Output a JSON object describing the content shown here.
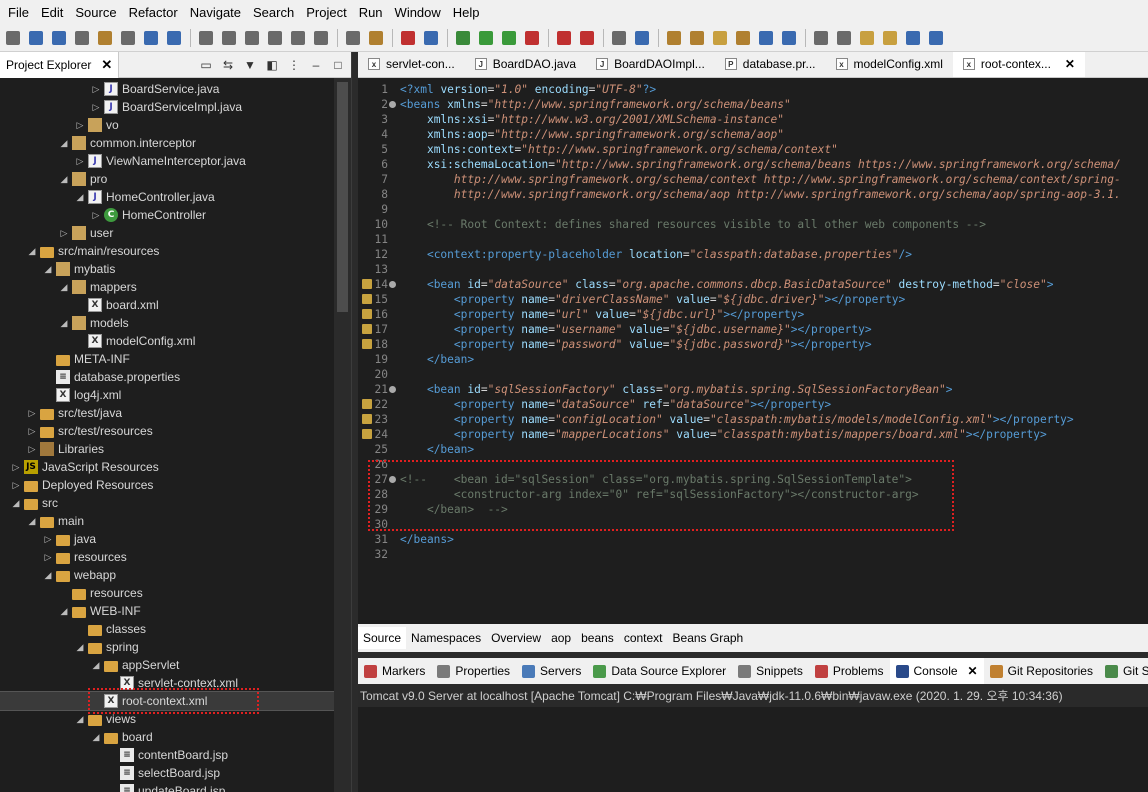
{
  "menu": [
    "File",
    "Edit",
    "Source",
    "Refactor",
    "Navigate",
    "Search",
    "Project",
    "Run",
    "Window",
    "Help"
  ],
  "explorer": {
    "title": "Project Explorer",
    "close": "✕",
    "tree": [
      {
        "label": "BoardService.java",
        "icon": "java",
        "tw": "▷",
        "indent": 104
      },
      {
        "label": "BoardServiceImpl.java",
        "icon": "java",
        "tw": "▷",
        "indent": 104
      },
      {
        "label": "vo",
        "icon": "pkg",
        "tw": "▷",
        "indent": 88
      },
      {
        "label": "common.interceptor",
        "icon": "pkg",
        "tw": "◢",
        "indent": 72
      },
      {
        "label": "ViewNameInterceptor.java",
        "icon": "java",
        "tw": "▷",
        "indent": 88
      },
      {
        "label": "pro",
        "icon": "pkg",
        "tw": "◢",
        "indent": 72
      },
      {
        "label": "HomeController.java",
        "icon": "java",
        "tw": "◢",
        "indent": 88
      },
      {
        "label": "HomeController",
        "icon": "cls",
        "tw": "▷",
        "indent": 104
      },
      {
        "label": "user",
        "icon": "pkg",
        "tw": "▷",
        "indent": 72
      },
      {
        "label": "src/main/resources",
        "icon": "folder",
        "tw": "◢",
        "indent": 40
      },
      {
        "label": "mybatis",
        "icon": "pkg",
        "tw": "◢",
        "indent": 56
      },
      {
        "label": "mappers",
        "icon": "pkg",
        "tw": "◢",
        "indent": 72
      },
      {
        "label": "board.xml",
        "icon": "xml",
        "tw": "",
        "indent": 88
      },
      {
        "label": "models",
        "icon": "pkg",
        "tw": "◢",
        "indent": 72
      },
      {
        "label": "modelConfig.xml",
        "icon": "xml",
        "tw": "",
        "indent": 88
      },
      {
        "label": "META-INF",
        "icon": "folder",
        "tw": "",
        "indent": 56
      },
      {
        "label": "database.properties",
        "icon": "props",
        "tw": "",
        "indent": 56
      },
      {
        "label": "log4j.xml",
        "icon": "xml",
        "tw": "",
        "indent": 56
      },
      {
        "label": "src/test/java",
        "icon": "folder",
        "tw": "▷",
        "indent": 40
      },
      {
        "label": "src/test/resources",
        "icon": "folder",
        "tw": "▷",
        "indent": 40
      },
      {
        "label": "Libraries",
        "icon": "lib",
        "tw": "▷",
        "indent": 40
      },
      {
        "label": "JavaScript Resources",
        "icon": "js",
        "tw": "▷",
        "indent": 24
      },
      {
        "label": "Deployed Resources",
        "icon": "folder",
        "tw": "▷",
        "indent": 24
      },
      {
        "label": "src",
        "icon": "folder",
        "tw": "◢",
        "indent": 24
      },
      {
        "label": "main",
        "icon": "folder",
        "tw": "◢",
        "indent": 40
      },
      {
        "label": "java",
        "icon": "folder",
        "tw": "▷",
        "indent": 56
      },
      {
        "label": "resources",
        "icon": "folder",
        "tw": "▷",
        "indent": 56
      },
      {
        "label": "webapp",
        "icon": "folder",
        "tw": "◢",
        "indent": 56
      },
      {
        "label": "resources",
        "icon": "folder",
        "tw": "",
        "indent": 72
      },
      {
        "label": "WEB-INF",
        "icon": "folder",
        "tw": "◢",
        "indent": 72
      },
      {
        "label": "classes",
        "icon": "folder",
        "tw": "",
        "indent": 88
      },
      {
        "label": "spring",
        "icon": "folder",
        "tw": "◢",
        "indent": 88
      },
      {
        "label": "appServlet",
        "icon": "folder",
        "tw": "◢",
        "indent": 104
      },
      {
        "label": "servlet-context.xml",
        "icon": "xml",
        "tw": "",
        "indent": 120
      },
      {
        "label": "root-context.xml",
        "icon": "xml",
        "tw": "",
        "indent": 104,
        "selected": true
      },
      {
        "label": "views",
        "icon": "folder",
        "tw": "◢",
        "indent": 88
      },
      {
        "label": "board",
        "icon": "folder",
        "tw": "◢",
        "indent": 104
      },
      {
        "label": "contentBoard.jsp",
        "icon": "props",
        "tw": "",
        "indent": 120
      },
      {
        "label": "selectBoard.jsp",
        "icon": "props",
        "tw": "",
        "indent": 120
      },
      {
        "label": "updateBoard.jsp",
        "icon": "props",
        "tw": "",
        "indent": 120
      }
    ]
  },
  "editor": {
    "tabs": [
      {
        "label": "servlet-con...",
        "icon": "x"
      },
      {
        "label": "BoardDAO.java",
        "icon": "J"
      },
      {
        "label": "BoardDAOImpl...",
        "icon": "J"
      },
      {
        "label": "database.pr...",
        "icon": "P"
      },
      {
        "label": "modelConfig.xml",
        "icon": "x"
      },
      {
        "label": "root-contex...",
        "icon": "x",
        "active": true
      }
    ],
    "close": "✕",
    "lines": [
      {
        "n": "1",
        "html": "<span class='pi'>&lt;?xml</span> <span class='att'>version</span>=<span class='val'>\"1.0\"</span> <span class='att'>encoding</span>=<span class='val'>\"UTF-8\"</span><span class='pi'>?&gt;</span>"
      },
      {
        "n": "2",
        "fold": true,
        "html": "<span class='tagn'>&lt;beans</span> <span class='att'>xmlns</span>=<span class='val'>\"http://www.springframework.org/schema/beans\"</span>"
      },
      {
        "n": "3",
        "html": "    <span class='att'>xmlns:xsi</span>=<span class='val'>\"http://www.w3.org/2001/XMLSchema-instance\"</span>"
      },
      {
        "n": "4",
        "html": "    <span class='att'>xmlns:aop</span>=<span class='val'>\"http://www.springframework.org/schema/aop\"</span>"
      },
      {
        "n": "5",
        "html": "    <span class='att'>xmlns:context</span>=<span class='val'>\"http://www.springframework.org/schema/context\"</span>"
      },
      {
        "n": "6",
        "html": "    <span class='att'>xsi:schemaLocation</span>=<span class='val'>\"http://www.springframework.org/schema/beans https://www.springframework.org/schema/</span>"
      },
      {
        "n": "7",
        "html": "        <span class='val'>http://www.springframework.org/schema/context http://www.springframework.org/schema/context/spring-</span>"
      },
      {
        "n": "8",
        "html": "        <span class='val'>http://www.springframework.org/schema/aop http://www.springframework.org/schema/aop/spring-aop-3.1.</span>"
      },
      {
        "n": "9",
        "html": ""
      },
      {
        "n": "10",
        "html": "    <span class='cmt'>&lt;!-- Root Context: defines shared resources visible to all other web components --&gt;</span>"
      },
      {
        "n": "11",
        "html": ""
      },
      {
        "n": "12",
        "html": "    <span class='tagn'>&lt;context:property-placeholder</span> <span class='att'>location</span>=<span class='val'>\"classpath:database.properties\"</span><span class='tagn'>/&gt;</span>"
      },
      {
        "n": "13",
        "html": ""
      },
      {
        "n": "14",
        "mark": true,
        "fold": true,
        "html": "    <span class='tagn'>&lt;bean</span> <span class='att'>id</span>=<span class='val'>\"dataSource\"</span> <span class='att'>class</span>=<span class='val'>\"org.apache.commons.dbcp.BasicDataSource\"</span> <span class='att'>destroy-method</span>=<span class='val'>\"close\"</span><span class='tagn'>&gt;</span>"
      },
      {
        "n": "15",
        "mark": true,
        "html": "        <span class='tagn'>&lt;property</span> <span class='att'>name</span>=<span class='val'>\"driverClassName\"</span> <span class='att'>value</span>=<span class='val'>\"${jdbc.driver}\"</span><span class='tagn'>&gt;&lt;/property&gt;</span>"
      },
      {
        "n": "16",
        "mark": true,
        "html": "        <span class='tagn'>&lt;property</span> <span class='att'>name</span>=<span class='val'>\"url\"</span> <span class='att'>value</span>=<span class='val'>\"${jdbc.url}\"</span><span class='tagn'>&gt;&lt;/property&gt;</span>"
      },
      {
        "n": "17",
        "mark": true,
        "html": "        <span class='tagn'>&lt;property</span> <span class='att'>name</span>=<span class='val'>\"username\"</span> <span class='att'>value</span>=<span class='val'>\"${jdbc.username}\"</span><span class='tagn'>&gt;&lt;/property&gt;</span>"
      },
      {
        "n": "18",
        "mark": true,
        "html": "        <span class='tagn'>&lt;property</span> <span class='att'>name</span>=<span class='val'>\"password\"</span> <span class='att'>value</span>=<span class='val'>\"${jdbc.password}\"</span><span class='tagn'>&gt;&lt;/property&gt;</span>"
      },
      {
        "n": "19",
        "html": "    <span class='tagn'>&lt;/bean&gt;</span>"
      },
      {
        "n": "20",
        "html": ""
      },
      {
        "n": "21",
        "fold": true,
        "html": "    <span class='tagn'>&lt;bean</span> <span class='att'>id</span>=<span class='val'>\"sqlSessionFactory\"</span> <span class='att'>class</span>=<span class='val'>\"org.mybatis.spring.SqlSessionFactoryBean\"</span><span class='tagn'>&gt;</span>"
      },
      {
        "n": "22",
        "mark": true,
        "html": "        <span class='tagn'>&lt;property</span> <span class='att'>name</span>=<span class='val'>\"dataSource\"</span> <span class='att'>ref</span>=<span class='val'>\"dataSource\"</span><span class='tagn'>&gt;&lt;/property&gt;</span>"
      },
      {
        "n": "23",
        "mark": true,
        "html": "        <span class='tagn'>&lt;property</span> <span class='att'>name</span>=<span class='val'>\"configLocation\"</span> <span class='att'>value</span>=<span class='val'>\"classpath:mybatis/models/modelConfig.xml\"</span><span class='tagn'>&gt;&lt;/property&gt;</span>"
      },
      {
        "n": "24",
        "mark": true,
        "html": "        <span class='tagn'>&lt;property</span> <span class='att'>name</span>=<span class='val'>\"mapperLocations\"</span> <span class='att'>value</span>=<span class='val'>\"classpath:mybatis/mappers/board.xml\"</span><span class='tagn'>&gt;&lt;/property&gt;</span>"
      },
      {
        "n": "25",
        "html": "    <span class='tagn'>&lt;/bean&gt;</span>"
      },
      {
        "n": "26",
        "html": ""
      },
      {
        "n": "27",
        "fold": true,
        "html": "<span class='cmt'>&lt;!--    &lt;bean id=\"sqlSession\" class=\"org.mybatis.spring.SqlSessionTemplate\"&gt;</span>"
      },
      {
        "n": "28",
        "html": "        <span class='cmt'>&lt;constructor-arg index=\"0\" ref=\"sqlSessionFactory\"&gt;&lt;/constructor-arg&gt;</span>"
      },
      {
        "n": "29",
        "html": "    <span class='cmt'>&lt;/bean&gt;  --&gt;</span>"
      },
      {
        "n": "30",
        "html": ""
      },
      {
        "n": "31",
        "html": "<span class='tagn'>&lt;/beans&gt;</span>"
      },
      {
        "n": "32",
        "html": ""
      }
    ],
    "source_tabs": [
      "Source",
      "Namespaces",
      "Overview",
      "aop",
      "beans",
      "context",
      "Beans Graph"
    ]
  },
  "bottom": {
    "tabs": [
      {
        "label": "Markers",
        "color": "#c04040"
      },
      {
        "label": "Properties",
        "color": "#7a7a7a"
      },
      {
        "label": "Servers",
        "color": "#4a7ab8"
      },
      {
        "label": "Data Source Explorer",
        "color": "#4a9a4a"
      },
      {
        "label": "Snippets",
        "color": "#7a7a7a"
      },
      {
        "label": "Problems",
        "color": "#c04040"
      },
      {
        "label": "Console",
        "color": "#2a4a8a",
        "active": true
      },
      {
        "label": "Git Repositories",
        "color": "#c08030"
      },
      {
        "label": "Git Stag",
        "color": "#4a8a4a"
      }
    ],
    "close": "✕",
    "console_text": "Tomcat v9.0 Server at localhost [Apache Tomcat] C:₩Program Files₩Java₩jdk-11.0.6₩bin₩javaw.exe (2020. 1. 29. 오후 10:34:36)"
  },
  "colors": {
    "highlight": "#e02020",
    "bg": "#1e1e1e"
  }
}
